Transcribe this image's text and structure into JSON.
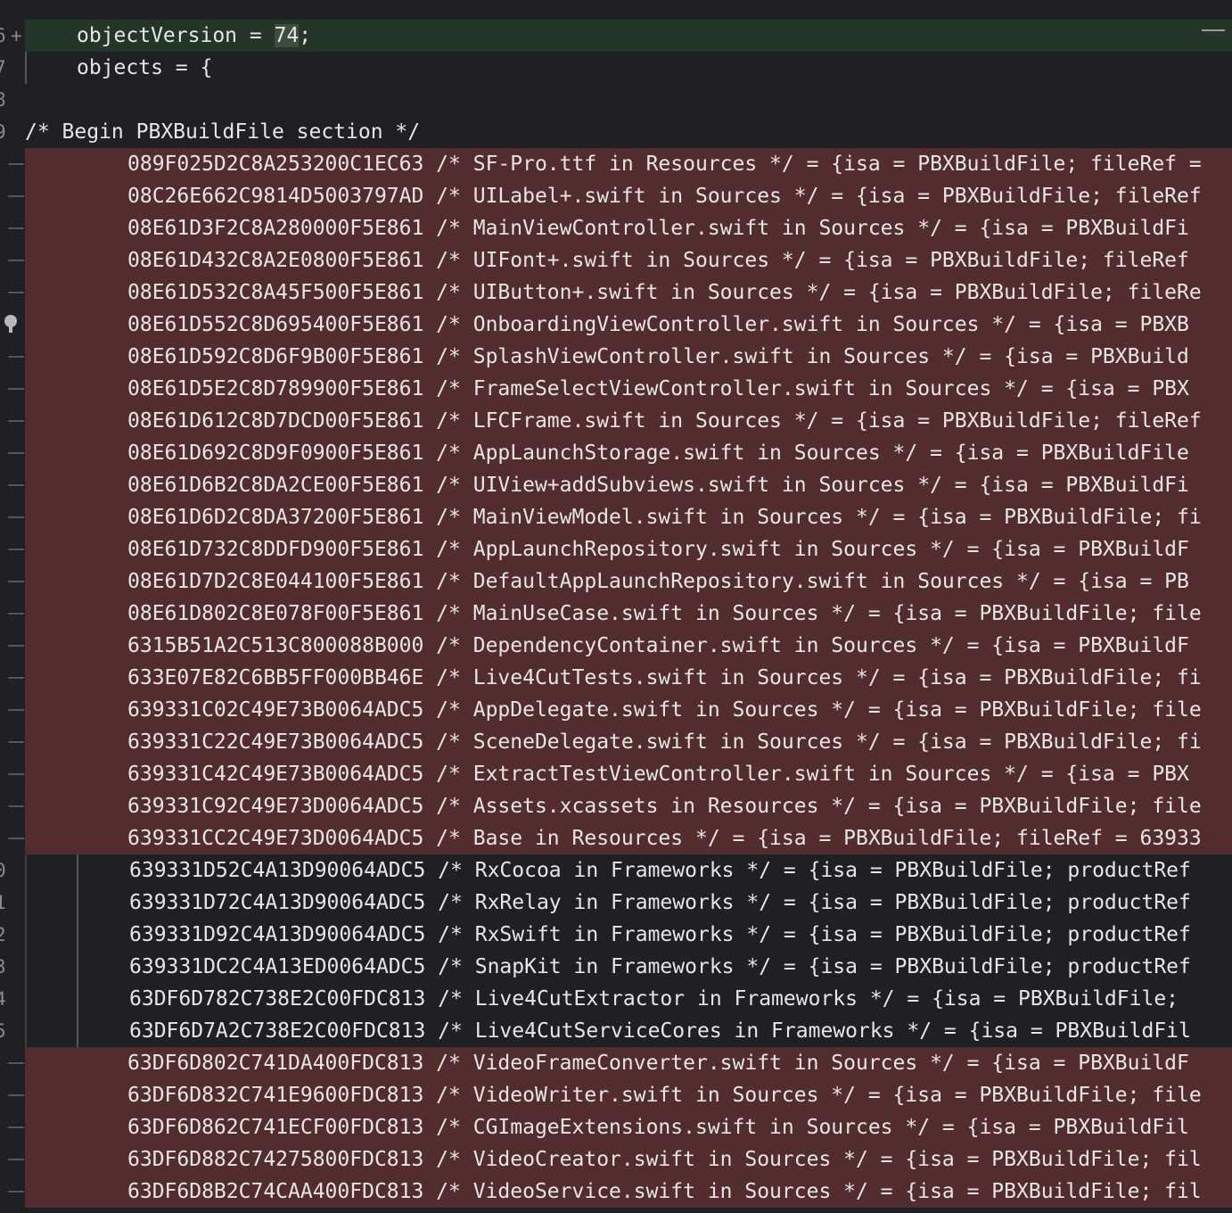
{
  "editor": {
    "lines": [
      {
        "gutter": "6",
        "marker": "plus",
        "kind": "changed",
        "indent": 58,
        "segments": [
          "objectVersion = ",
          "74",
          ";"
        ]
      },
      {
        "gutter": "7",
        "marker": "",
        "kind": "ctx",
        "indent": 58,
        "text": "objects = {"
      },
      {
        "gutter": "8",
        "marker": "",
        "kind": "blank",
        "indent": 0,
        "text": ""
      },
      {
        "gutter": "9",
        "marker": "",
        "kind": "plain",
        "indent": 0,
        "text": "/* Begin PBXBuildFile section */"
      },
      {
        "gutter": "",
        "marker": "dash",
        "kind": "removed",
        "indent": 115,
        "text": "089F025D2C8A253200C1EC63 /* SF-Pro.ttf in Resources */ = {isa = PBXBuildFile; fileRef ="
      },
      {
        "gutter": "",
        "marker": "dash",
        "kind": "removed",
        "indent": 115,
        "text": "08C26E662C9814D5003797AD /* UILabel+.swift in Sources */ = {isa = PBXBuildFile; fileRef"
      },
      {
        "gutter": "",
        "marker": "dash",
        "kind": "removed",
        "indent": 115,
        "text": "08E61D3F2C8A280000F5E861 /* MainViewController.swift in Sources */ = {isa = PBXBuildFi"
      },
      {
        "gutter": "",
        "marker": "dash",
        "kind": "removed",
        "indent": 115,
        "text": "08E61D432C8A2E0800F5E861 /* UIFont+.swift in Sources */ = {isa = PBXBuildFile; fileRef"
      },
      {
        "gutter": "",
        "marker": "dash",
        "kind": "removed",
        "indent": 115,
        "text": "08E61D532C8A45F500F5E861 /* UIButton+.swift in Sources */ = {isa = PBXBuildFile; fileRe"
      },
      {
        "gutter": "",
        "marker": "bulb",
        "kind": "removed",
        "indent": 115,
        "text": "08E61D552C8D695400F5E861 /* OnboardingViewController.swift in Sources */ = {isa = PBXB"
      },
      {
        "gutter": "",
        "marker": "dash",
        "kind": "removed",
        "indent": 115,
        "text": "08E61D592C8D6F9B00F5E861 /* SplashViewController.swift in Sources */ = {isa = PBXBuild"
      },
      {
        "gutter": "",
        "marker": "dash",
        "kind": "removed",
        "indent": 115,
        "text": "08E61D5E2C8D789900F5E861 /* FrameSelectViewController.swift in Sources */ = {isa = PBX"
      },
      {
        "gutter": "",
        "marker": "dash",
        "kind": "removed",
        "indent": 115,
        "text": "08E61D612C8D7DCD00F5E861 /* LFCFrame.swift in Sources */ = {isa = PBXBuildFile; fileRef"
      },
      {
        "gutter": "",
        "marker": "dash",
        "kind": "removed",
        "indent": 115,
        "text": "08E61D692C8D9F0900F5E861 /* AppLaunchStorage.swift in Sources */ = {isa = PBXBuildFile"
      },
      {
        "gutter": "",
        "marker": "dash",
        "kind": "removed",
        "indent": 115,
        "text": "08E61D6B2C8DA2CE00F5E861 /* UIView+addSubviews.swift in Sources */ = {isa = PBXBuildFi"
      },
      {
        "gutter": "",
        "marker": "dash",
        "kind": "removed",
        "indent": 115,
        "text": "08E61D6D2C8DA37200F5E861 /* MainViewModel.swift in Sources */ = {isa = PBXBuildFile; fi"
      },
      {
        "gutter": "",
        "marker": "dash",
        "kind": "removed",
        "indent": 115,
        "text": "08E61D732C8DDFD900F5E861 /* AppLaunchRepository.swift in Sources */ = {isa = PBXBuildF"
      },
      {
        "gutter": "",
        "marker": "dash",
        "kind": "removed",
        "indent": 115,
        "text": "08E61D7D2C8E044100F5E861 /* DefaultAppLaunchRepository.swift in Sources */ = {isa = PB"
      },
      {
        "gutter": "",
        "marker": "dash",
        "kind": "removed",
        "indent": 115,
        "text": "08E61D802C8E078F00F5E861 /* MainUseCase.swift in Sources */ = {isa = PBXBuildFile; file"
      },
      {
        "gutter": "",
        "marker": "dash",
        "kind": "removed",
        "indent": 115,
        "text": "6315B51A2C513C800088B000 /* DependencyContainer.swift in Sources */ = {isa = PBXBuildF"
      },
      {
        "gutter": "",
        "marker": "dash",
        "kind": "removed",
        "indent": 115,
        "text": "633E07E82C6BB5FF000BB46E /* Live4CutTests.swift in Sources */ = {isa = PBXBuildFile; fi"
      },
      {
        "gutter": "",
        "marker": "dash",
        "kind": "removed",
        "indent": 115,
        "text": "639331C02C49E73B0064ADC5 /* AppDelegate.swift in Sources */ = {isa = PBXBuildFile; file"
      },
      {
        "gutter": "",
        "marker": "dash",
        "kind": "removed",
        "indent": 115,
        "text": "639331C22C49E73B0064ADC5 /* SceneDelegate.swift in Sources */ = {isa = PBXBuildFile; fi"
      },
      {
        "gutter": "",
        "marker": "dash",
        "kind": "removed",
        "indent": 115,
        "text": "639331C42C49E73B0064ADC5 /* ExtractTestViewController.swift in Sources */ = {isa = PBX"
      },
      {
        "gutter": "",
        "marker": "dash",
        "kind": "removed",
        "indent": 115,
        "text": "639331C92C49E73D0064ADC5 /* Assets.xcassets in Resources */ = {isa = PBXBuildFile; file"
      },
      {
        "gutter": "",
        "marker": "dash",
        "kind": "removed",
        "indent": 115,
        "text": "639331CC2C49E73D0064ADC5 /* Base in Resources */ = {isa = PBXBuildFile; fileRef = 63933"
      },
      {
        "gutter": "0",
        "marker": "",
        "kind": "fw",
        "indent": 115,
        "text": "639331D52C4A13D90064ADC5 /* RxCocoa in Frameworks */ = {isa = PBXBuildFile; productRef"
      },
      {
        "gutter": "1",
        "marker": "",
        "kind": "fw",
        "indent": 115,
        "text": "639331D72C4A13D90064ADC5 /* RxRelay in Frameworks */ = {isa = PBXBuildFile; productRef"
      },
      {
        "gutter": "2",
        "marker": "",
        "kind": "fw",
        "indent": 115,
        "text": "639331D92C4A13D90064ADC5 /* RxSwift in Frameworks */ = {isa = PBXBuildFile; productRef"
      },
      {
        "gutter": "3",
        "marker": "",
        "kind": "fw",
        "indent": 115,
        "text": "639331DC2C4A13ED0064ADC5 /* SnapKit in Frameworks */ = {isa = PBXBuildFile; productRef"
      },
      {
        "gutter": "4",
        "marker": "",
        "kind": "fw",
        "indent": 115,
        "text": "63DF6D782C738E2C00FDC813 /* Live4CutExtractor in Frameworks */ = {isa = PBXBuildFile;"
      },
      {
        "gutter": "5",
        "marker": "",
        "kind": "fw",
        "indent": 115,
        "text": "63DF6D7A2C738E2C00FDC813 /* Live4CutServiceCores in Frameworks */ = {isa = PBXBuildFil"
      },
      {
        "gutter": "",
        "marker": "dash",
        "kind": "removed",
        "indent": 115,
        "text": "63DF6D802C741DA400FDC813 /* VideoFrameConverter.swift in Sources */ = {isa = PBXBuildF"
      },
      {
        "gutter": "",
        "marker": "dash",
        "kind": "removed",
        "indent": 115,
        "text": "63DF6D832C741E9600FDC813 /* VideoWriter.swift in Sources */ = {isa = PBXBuildFile; file"
      },
      {
        "gutter": "",
        "marker": "dash",
        "kind": "removed",
        "indent": 115,
        "text": "63DF6D862C741ECF00FDC813 /* CGImageExtensions.swift in Sources */ = {isa = PBXBuildFil"
      },
      {
        "gutter": "",
        "marker": "dash",
        "kind": "removed",
        "indent": 115,
        "text": "63DF6D882C74275800FDC813 /* VideoCreator.swift in Sources */ = {isa = PBXBuildFile; fil"
      },
      {
        "gutter": "",
        "marker": "dash",
        "kind": "removed",
        "indent": 115,
        "text": "63DF6D8B2C74CAA400FDC813 /* VideoService.swift in Sources */ = {isa = PBXBuildFile; fil"
      }
    ]
  }
}
